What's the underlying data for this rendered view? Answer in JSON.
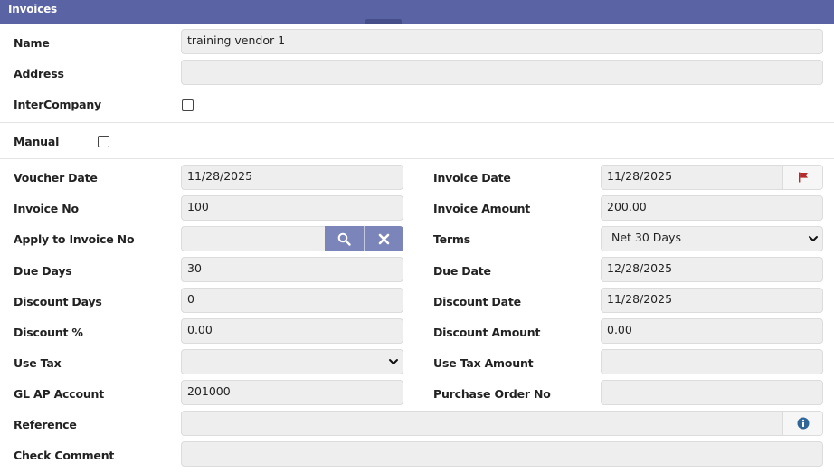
{
  "header": {
    "title": "Invoices"
  },
  "vendor": {
    "name_label": "Name",
    "name_value": "training vendor 1",
    "address_label": "Address",
    "address_value": "",
    "intercompany_label": "InterCompany",
    "manual_label": "Manual"
  },
  "form": {
    "voucher_date": {
      "label": "Voucher Date",
      "value": "11/28/2025"
    },
    "invoice_date": {
      "label": "Invoice Date",
      "value": "11/28/2025"
    },
    "invoice_no": {
      "label": "Invoice No",
      "value": "100"
    },
    "invoice_amount": {
      "label": "Invoice Amount",
      "value": "200.00"
    },
    "apply_to_invoice_no": {
      "label": "Apply to Invoice No",
      "value": ""
    },
    "terms": {
      "label": "Terms",
      "value": "Net 30 Days"
    },
    "due_days": {
      "label": "Due Days",
      "value": "30"
    },
    "due_date": {
      "label": "Due Date",
      "value": "12/28/2025"
    },
    "discount_days": {
      "label": "Discount Days",
      "value": "0"
    },
    "discount_date": {
      "label": "Discount Date",
      "value": "11/28/2025"
    },
    "discount_pct": {
      "label": "Discount %",
      "value": "0.00"
    },
    "discount_amount": {
      "label": "Discount Amount",
      "value": "0.00"
    },
    "use_tax": {
      "label": "Use Tax",
      "value": ""
    },
    "use_tax_amount": {
      "label": "Use Tax Amount",
      "value": ""
    },
    "gl_ap_account": {
      "label": "GL AP Account",
      "value": "201000"
    },
    "purchase_order_no": {
      "label": "Purchase Order No",
      "value": ""
    },
    "reference": {
      "label": "Reference",
      "value": ""
    },
    "check_comment": {
      "label": "Check Comment",
      "value": ""
    }
  },
  "icons": {
    "flag": "flag-icon",
    "search": "search-icon",
    "clear": "close-icon",
    "info": "info-icon",
    "chevron": "chevron-down-icon"
  },
  "colors": {
    "header_bg": "#5a63a3",
    "button_bg": "#7c85b9",
    "flag": "#b52a2a",
    "info": "#2f6597",
    "field_bg": "#eeeeee"
  }
}
